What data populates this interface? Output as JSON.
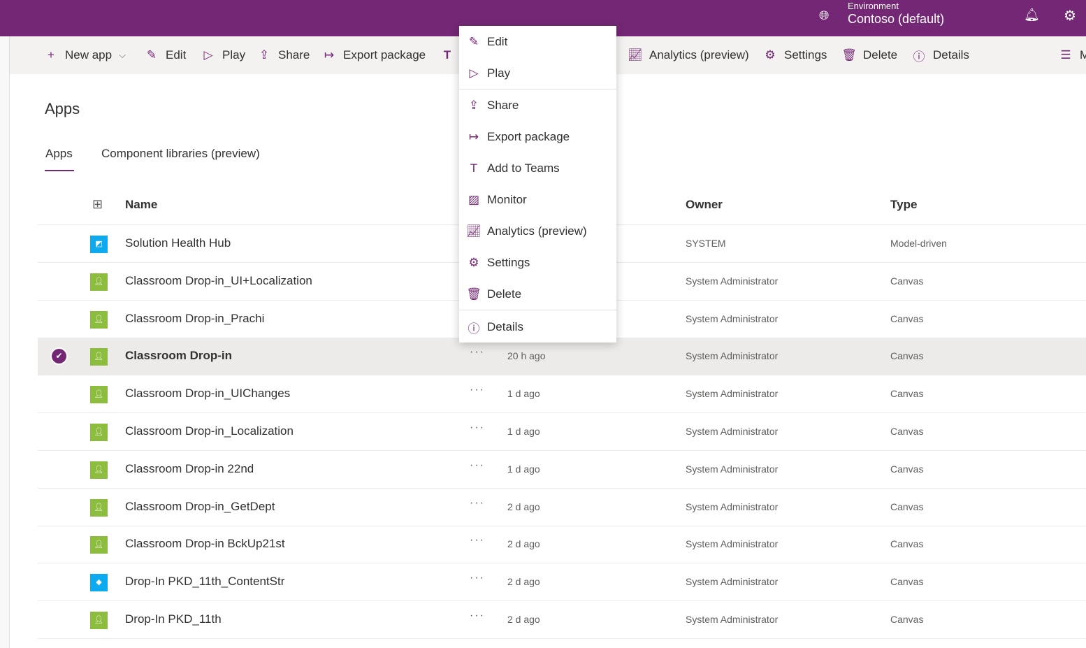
{
  "header": {
    "env_label": "Environment",
    "env_name": "Contoso (default)",
    "colors": {
      "brand": "#742774"
    }
  },
  "toolbar": {
    "items": [
      {
        "label": "New app",
        "icon": "plus-icon"
      },
      {
        "label": "Edit",
        "icon": "pencil-icon"
      },
      {
        "label": "Play",
        "icon": "play-icon"
      },
      {
        "label": "Share",
        "icon": "share-icon"
      },
      {
        "label": "Export package",
        "icon": "export-icon"
      },
      {
        "label": "Analytics (preview)",
        "icon": "chart-icon"
      },
      {
        "label": "Settings",
        "icon": "gear-icon"
      },
      {
        "label": "Delete",
        "icon": "trash-icon"
      },
      {
        "label": "Details",
        "icon": "info-icon"
      }
    ],
    "overflow_label": "M"
  },
  "page": {
    "title": "Apps",
    "tabs": [
      {
        "label": "Apps",
        "active": true
      },
      {
        "label": "Component libraries (preview)",
        "active": false
      }
    ]
  },
  "table": {
    "columns": {
      "name": "Name",
      "owner": "Owner",
      "type": "Type"
    },
    "rows": [
      {
        "name": "Solution Health Hub",
        "modified": "",
        "owner": "SYSTEM",
        "type": "Model-driven",
        "kind": "model"
      },
      {
        "name": "Classroom Drop-in_UI+Localization",
        "modified": "",
        "owner": "System Administrator",
        "type": "Canvas",
        "kind": "canvas"
      },
      {
        "name": "Classroom Drop-in_Prachi",
        "modified": "",
        "owner": "System Administrator",
        "type": "Canvas",
        "kind": "canvas"
      },
      {
        "name": "Classroom Drop-in",
        "modified": "20 h ago",
        "owner": "System Administrator",
        "type": "Canvas",
        "kind": "canvas",
        "selected": true
      },
      {
        "name": "Classroom Drop-in_UIChanges",
        "modified": "1 d ago",
        "owner": "System Administrator",
        "type": "Canvas",
        "kind": "canvas"
      },
      {
        "name": "Classroom Drop-in_Localization",
        "modified": "1 d ago",
        "owner": "System Administrator",
        "type": "Canvas",
        "kind": "canvas"
      },
      {
        "name": "Classroom Drop-in 22nd",
        "modified": "1 d ago",
        "owner": "System Administrator",
        "type": "Canvas",
        "kind": "canvas"
      },
      {
        "name": "Classroom Drop-in_GetDept",
        "modified": "2 d ago",
        "owner": "System Administrator",
        "type": "Canvas",
        "kind": "canvas"
      },
      {
        "name": "Classroom Drop-in BckUp21st",
        "modified": "2 d ago",
        "owner": "System Administrator",
        "type": "Canvas",
        "kind": "canvas"
      },
      {
        "name": "Drop-In PKD_11th_ContentStr",
        "modified": "2 d ago",
        "owner": "System Administrator",
        "type": "Canvas",
        "kind": "blue"
      },
      {
        "name": "Drop-In PKD_11th",
        "modified": "2 d ago",
        "owner": "System Administrator",
        "type": "Canvas",
        "kind": "canvas"
      }
    ]
  },
  "context_menu": {
    "items": [
      {
        "label": "Edit",
        "icon": "pencil-icon"
      },
      {
        "label": "Play",
        "icon": "play-icon"
      },
      {
        "label": "Share",
        "icon": "share-icon"
      },
      {
        "label": "Export package",
        "icon": "export-icon"
      },
      {
        "label": "Add to Teams",
        "icon": "teams-icon"
      },
      {
        "label": "Monitor",
        "icon": "monitor-icon"
      },
      {
        "label": "Analytics (preview)",
        "icon": "chart-icon"
      },
      {
        "label": "Settings",
        "icon": "gear-icon"
      },
      {
        "label": "Delete",
        "icon": "trash-icon"
      },
      {
        "label": "Details",
        "icon": "info-icon"
      }
    ]
  }
}
